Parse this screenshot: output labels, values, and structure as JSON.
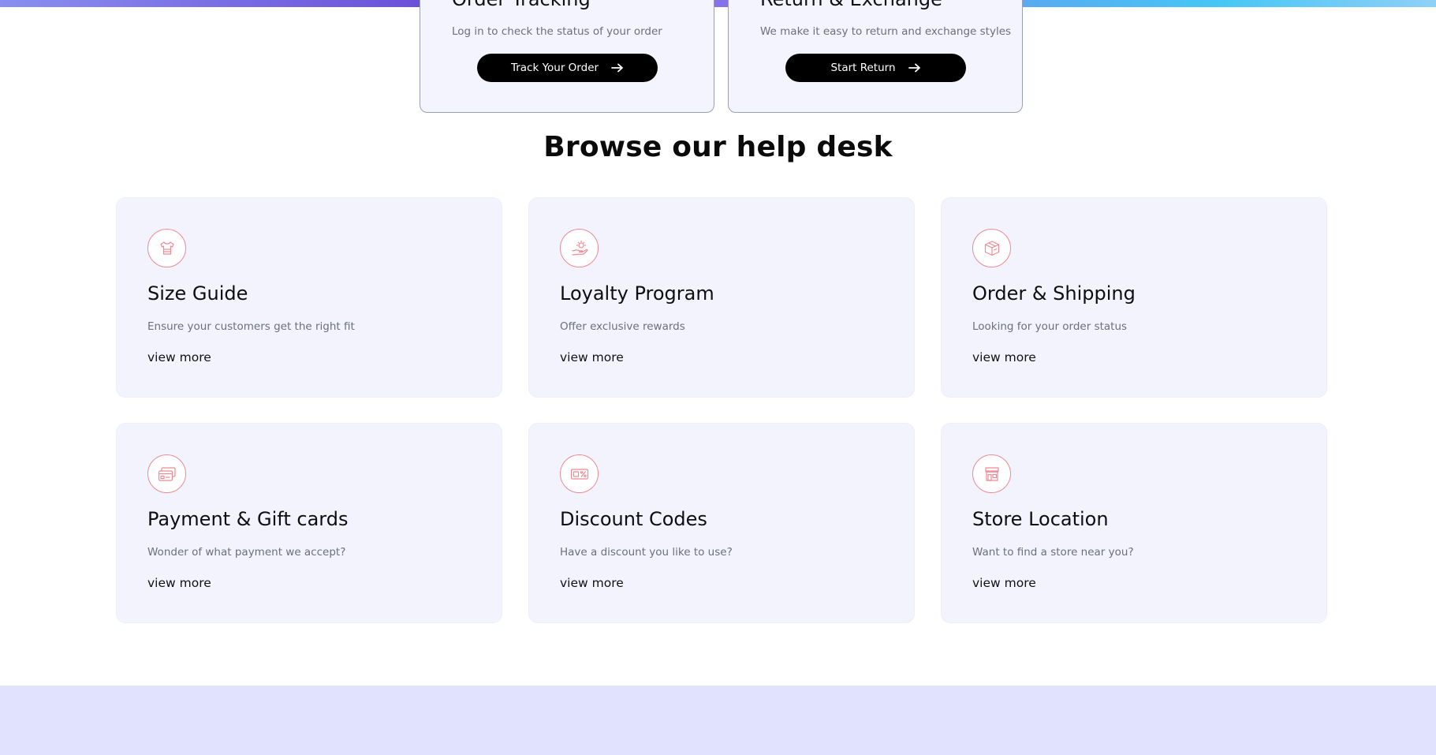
{
  "service_cards": [
    {
      "title": "Order Tracking",
      "description": "Log in to check the status of your order",
      "button_label": "Track Your Order"
    },
    {
      "title": "Return & Exchange",
      "description": "We make it easy to return and exchange styles",
      "button_label": "Start Return"
    }
  ],
  "help_desk": {
    "title": "Browse our help desk",
    "cards": [
      {
        "icon": "tshirt-icon",
        "title": "Size Guide",
        "description": "Ensure your customers get the right fit",
        "link": "view more"
      },
      {
        "icon": "hand-gift-icon",
        "title": "Loyalty Program",
        "description": "Offer exclusive rewards",
        "link": "view more"
      },
      {
        "icon": "package-box-icon",
        "title": "Order & Shipping",
        "description": "Looking for your order status",
        "link": "view more"
      },
      {
        "icon": "credit-card-icon",
        "title": "Payment & Gift cards",
        "description": "Wonder of what payment we accept?",
        "link": "view more"
      },
      {
        "icon": "discount-coupon-icon",
        "title": "Discount Codes",
        "description": "Have a discount you like to use?",
        "link": "view more"
      },
      {
        "icon": "storefront-icon",
        "title": "Store Location",
        "description": "Want to find a store near you?",
        "link": "view more"
      }
    ]
  },
  "colors": {
    "accent_icon": "#ee8a93",
    "card_background": "#f2f3fd",
    "button_background": "#000000",
    "bottom_section": "#e1e2fd"
  }
}
